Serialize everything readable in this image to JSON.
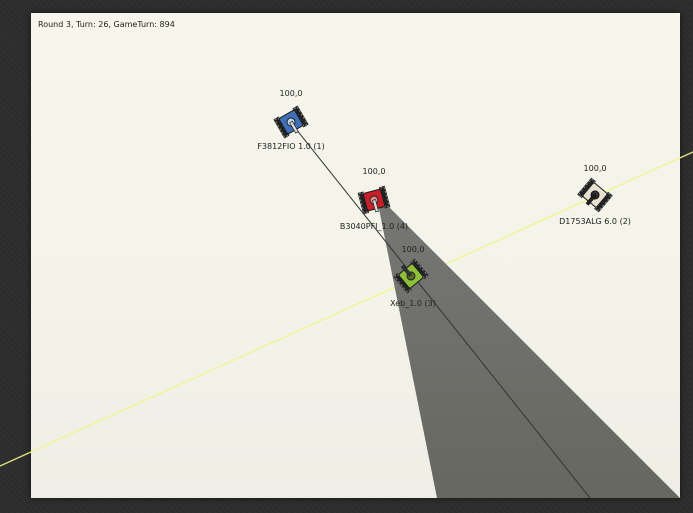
{
  "status_text": "Round 3, Turn: 26, GameTurn: 894",
  "colors": {
    "background": "#2d2d2d",
    "arena": "#f5f5ec",
    "radar_cone": "#6b6b66",
    "scan_line": "#ffff99"
  },
  "tanks": [
    {
      "energy": "100,0",
      "label": "F3812FIO 1.0 (1)",
      "body_color": "#3f6fb8",
      "icon": "tank-icon"
    },
    {
      "energy": "100,0",
      "label": "B3040PFI_1.0 (4)",
      "body_color": "#c8202a",
      "icon": "tank-icon"
    },
    {
      "energy": "100,0",
      "label": "Xeb_1.0 (3)",
      "body_color": "#8fbf3a",
      "icon": "tank-icon"
    },
    {
      "energy": "100,0",
      "label": "D1753ALG 6.0 (2)",
      "body_color": "#e8e0d0",
      "icon": "tank-icon"
    }
  ]
}
